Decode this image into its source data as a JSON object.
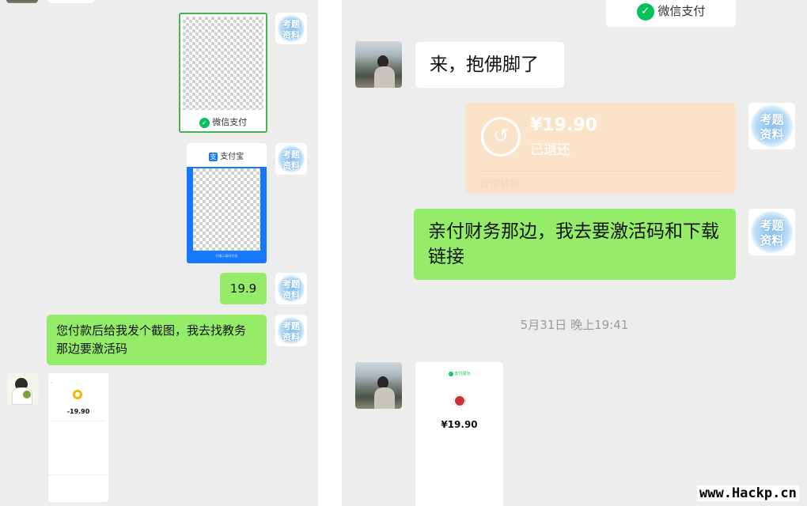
{
  "left": {
    "wechat_qr_label": "微信支付",
    "alipay_title": "支付宝",
    "alipay_caption": "扫描二维码付款",
    "amount_message": "19.9",
    "request_message": "您付款后给我发个截图，我去找教务那边要激活码",
    "receipt": {
      "header_left": "",
      "header_right": "",
      "merchant": "",
      "amount": "-19.90",
      "rows": [],
      "footer_left": "",
      "footer_right": "",
      "footer_more": ""
    }
  },
  "right": {
    "wechat_pay_top": "微信支付",
    "message_1": "来，抱佛脚了",
    "transfer": {
      "amount": "¥19.90",
      "status": "已退还",
      "footer": "微信转账"
    },
    "message_2": "亲付财务那边，我去要激活码和下载链接",
    "timestamp": "5月31日 晚上19:41",
    "payment_shot": {
      "status_time": "",
      "top_label": "支付成功",
      "payee": "",
      "amount": "¥19.90"
    }
  },
  "avatar_logo_text": [
    "考题",
    "资料"
  ],
  "watermark": "www.Hackp.cn"
}
